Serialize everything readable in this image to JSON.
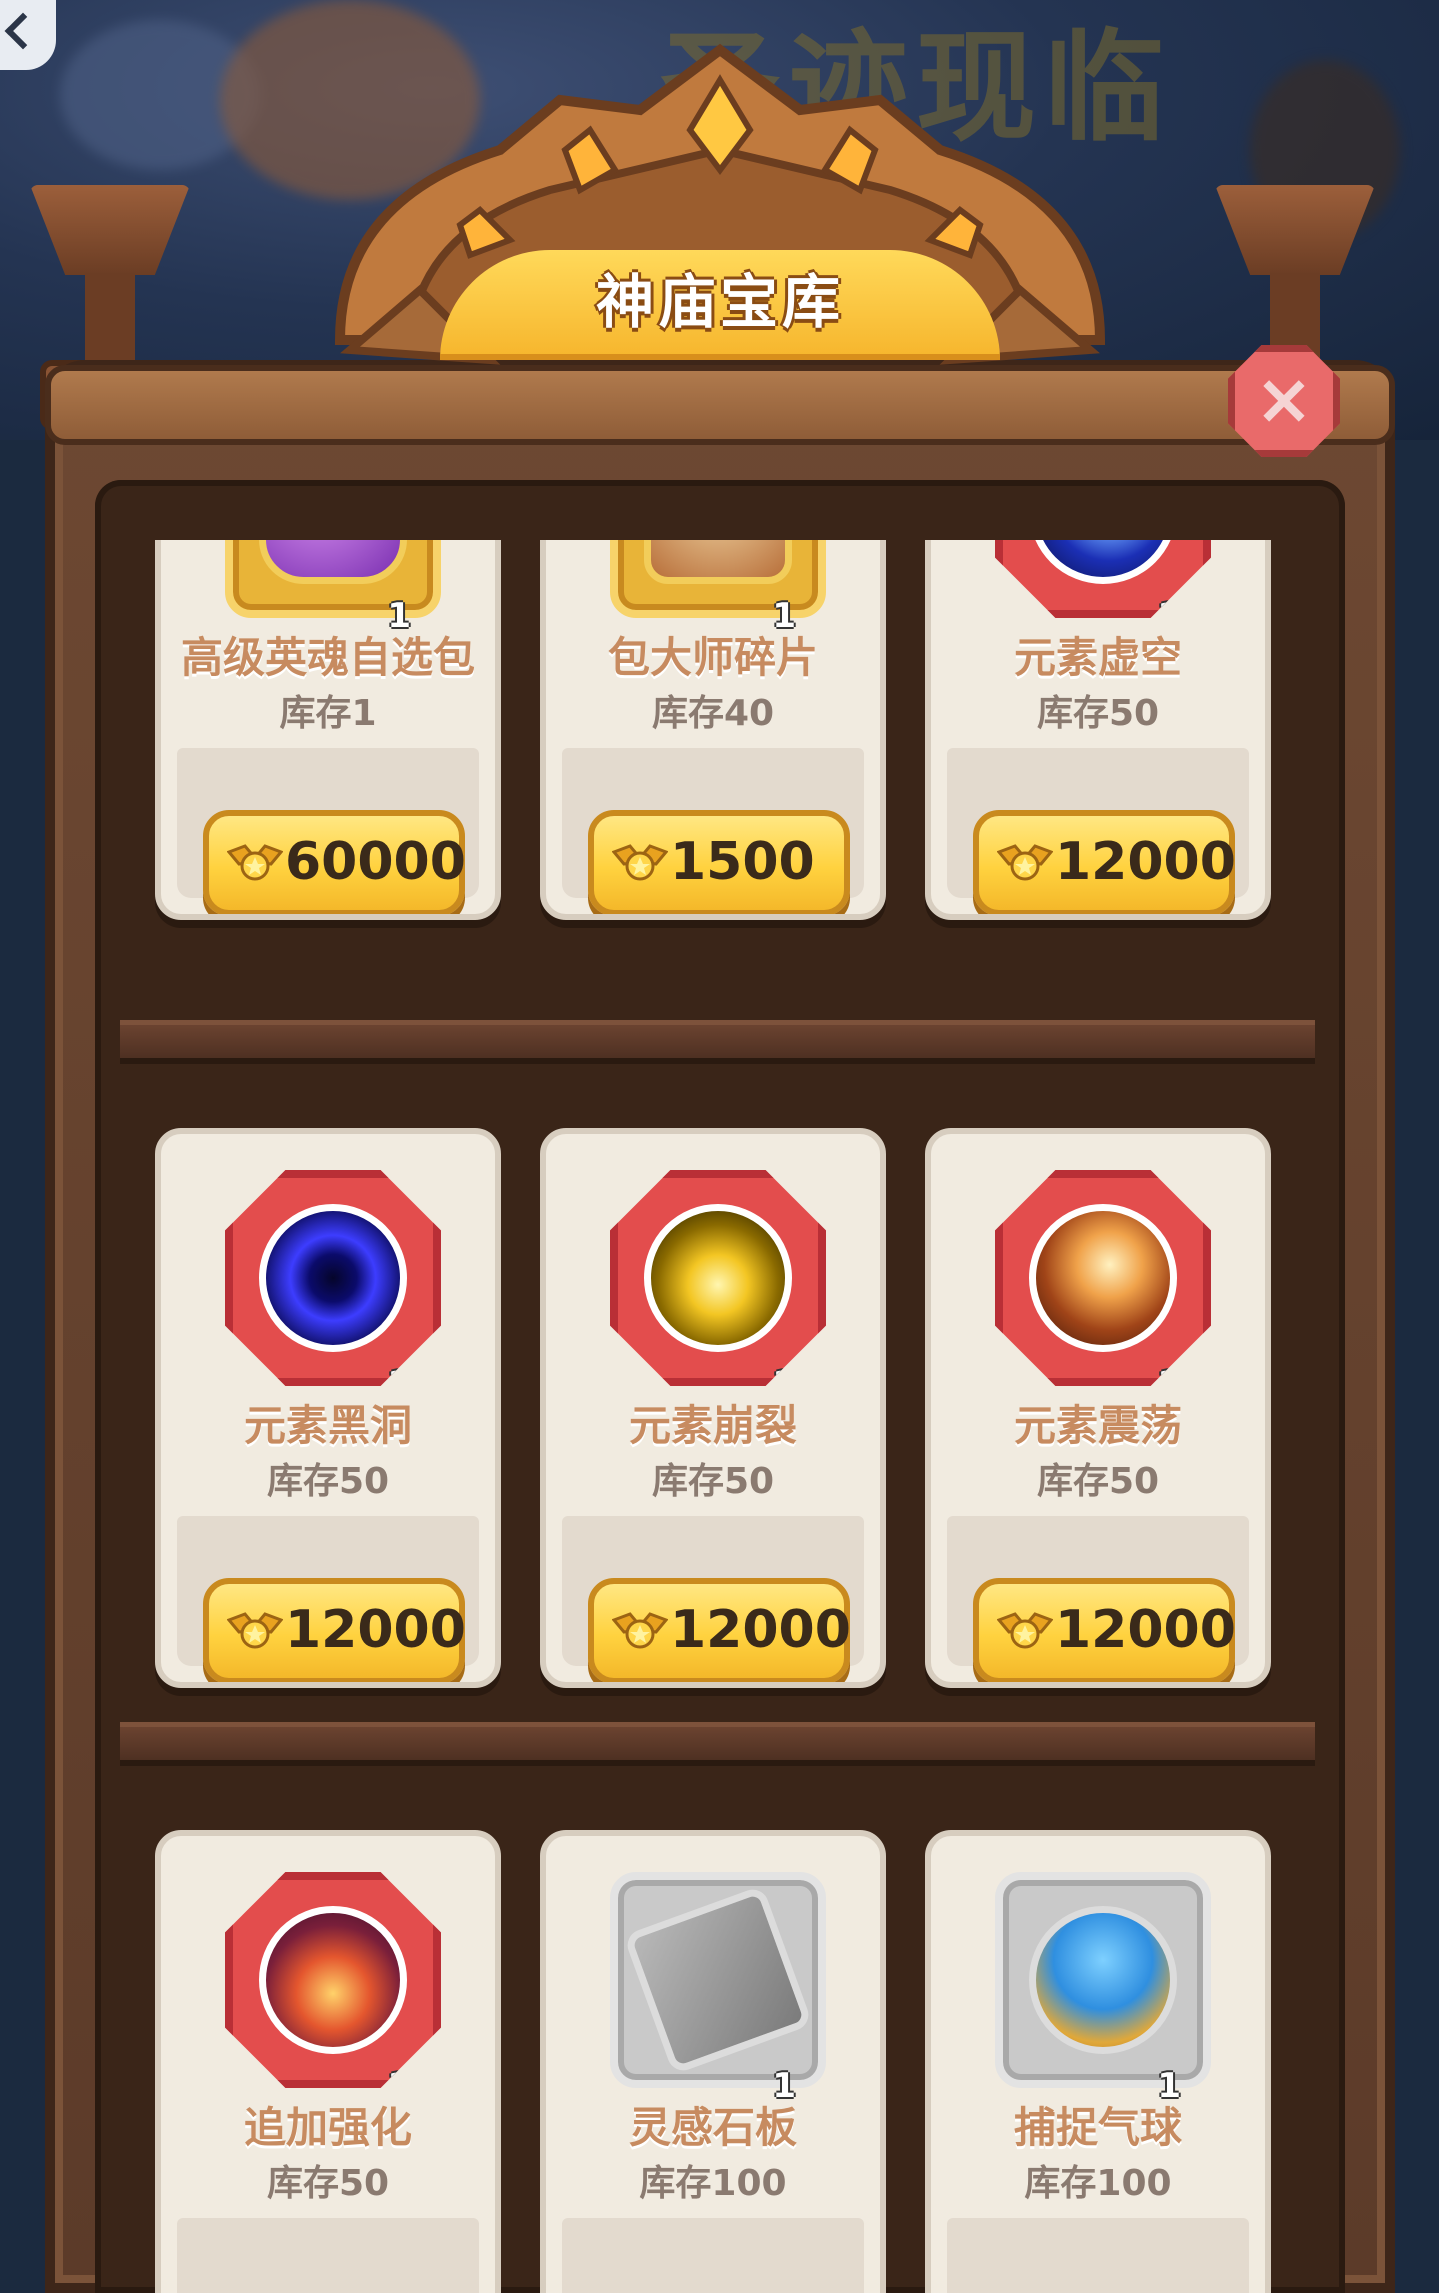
{
  "panel": {
    "title": "神庙宝库",
    "close_label": "×"
  },
  "background": {
    "banner_text": "圣迹现临"
  },
  "colors": {
    "gold_tile": "#e8b438",
    "red_tile": "#e34d4d",
    "gray_tile": "#c9c9c9",
    "price_button": "#ffd23f",
    "wood": "#5c3b29"
  },
  "items": [
    {
      "name": "高级英魂自选包",
      "stock": "库存1",
      "qty": "1",
      "price": "60000",
      "tile": "gold",
      "icon": "purple-soul-bag-icon"
    },
    {
      "name": "包大师碎片",
      "stock": "库存40",
      "qty": "1",
      "price": "1500",
      "tile": "gold",
      "icon": "hero-portrait-icon"
    },
    {
      "name": "元素虚空",
      "stock": "库存50",
      "qty": "1",
      "price": "12000",
      "tile": "red",
      "icon": "void-orb-icon"
    },
    {
      "name": "元素黑洞",
      "stock": "库存50",
      "qty": "1",
      "price": "12000",
      "tile": "red",
      "icon": "black-hole-icon"
    },
    {
      "name": "元素崩裂",
      "stock": "库存50",
      "qty": "1",
      "price": "12000",
      "tile": "red",
      "icon": "crack-burst-icon"
    },
    {
      "name": "元素震荡",
      "stock": "库存50",
      "qty": "1",
      "price": "12000",
      "tile": "red",
      "icon": "quake-icon"
    },
    {
      "name": "追加强化",
      "stock": "库存50",
      "qty": "1",
      "price": "",
      "tile": "red",
      "icon": "power-up-icon"
    },
    {
      "name": "灵感石板",
      "stock": "库存100",
      "qty": "1",
      "price": "",
      "tile": "gray",
      "icon": "stone-tablet-icon"
    },
    {
      "name": "捕捉气球",
      "stock": "库存100",
      "qty": "1",
      "price": "",
      "tile": "gray",
      "icon": "catch-balloon-icon"
    }
  ]
}
